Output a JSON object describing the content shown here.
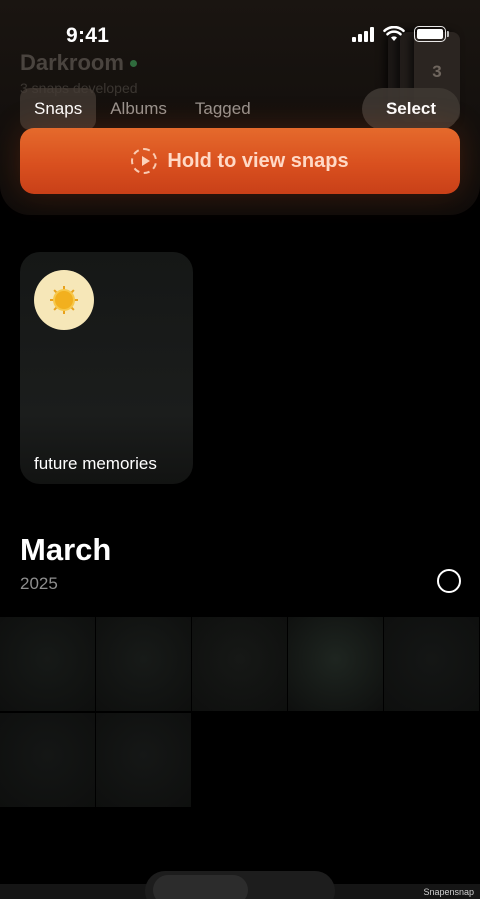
{
  "status_bar": {
    "time": "9:41",
    "icons": [
      "signal-icon",
      "wifi-icon",
      "battery-icon"
    ]
  },
  "darkroom": {
    "title": "Darkroom",
    "subtitle": "3 snaps developed",
    "film_count": "3",
    "status_color": "#2f6b3d"
  },
  "tabs": [
    {
      "label": "Snaps",
      "active": true
    },
    {
      "label": "Albums",
      "active": false
    },
    {
      "label": "Tagged",
      "active": false
    }
  ],
  "select_button": "Select",
  "hold_button": {
    "label": "Hold to view snaps",
    "icon": "play-circle-dashed-icon",
    "color": "#d9501f"
  },
  "album": {
    "name": "future memories",
    "icon": "sun-icon"
  },
  "month_section": {
    "month": "March",
    "year": "2025"
  },
  "photos": [
    {
      "tint": "#161917"
    },
    {
      "tint": "#171a18"
    },
    {
      "tint": "#161816"
    },
    {
      "tint": "#1e2520"
    },
    {
      "tint": "#141615"
    },
    {
      "tint": "#141615"
    },
    {
      "tint": "#151716"
    }
  ],
  "watermark": "Snapensnap"
}
